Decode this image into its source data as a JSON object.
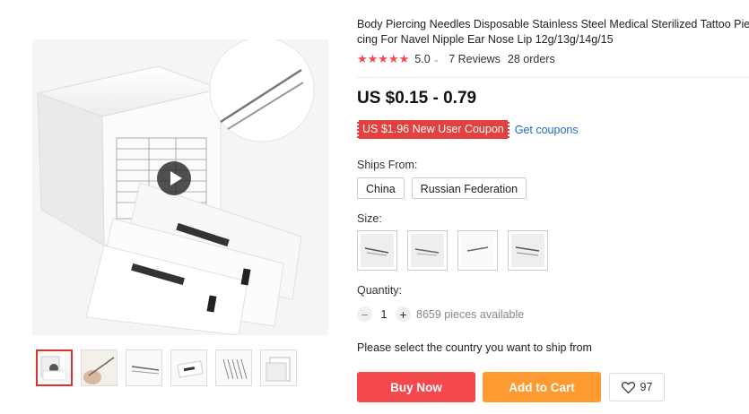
{
  "product": {
    "title_line1": "Body Piercing Needles Disposable Stainless Steel Medical Sterilized Tattoo Pier",
    "title_line2": "cing For Navel Nipple Ear Nose Lip 12g/13g/14g/15",
    "rating": "5.0",
    "stars": "★★★★★",
    "reviews": "7 Reviews",
    "orders": "28 orders",
    "price": "US $0.15 - 0.79"
  },
  "coupon": {
    "badge": "US $1.96 New User Coupon",
    "link": "Get coupons"
  },
  "ships_from": {
    "label": "Ships From:",
    "options": [
      "China",
      "Russian Federation"
    ]
  },
  "size": {
    "label": "Size:",
    "options": [
      "size-option-1",
      "size-option-2",
      "size-option-3",
      "size-option-4"
    ]
  },
  "quantity": {
    "label": "Quantity:",
    "minus": "−",
    "plus": "+",
    "value": "1",
    "available": "8659 pieces available"
  },
  "shipping_message": "Please select the country you want to ship from",
  "actions": {
    "buy_now": "Buy Now",
    "add_to_cart": "Add to Cart",
    "wishlist_count": "97"
  },
  "icons": {
    "heart": "heart-icon",
    "play": "play-icon",
    "caret": "chevron-down-icon"
  },
  "colors": {
    "accent_red": "#f4494c",
    "accent_orange": "#fd9a30",
    "link_blue": "#1a6ec2",
    "star": "#f5484f"
  }
}
